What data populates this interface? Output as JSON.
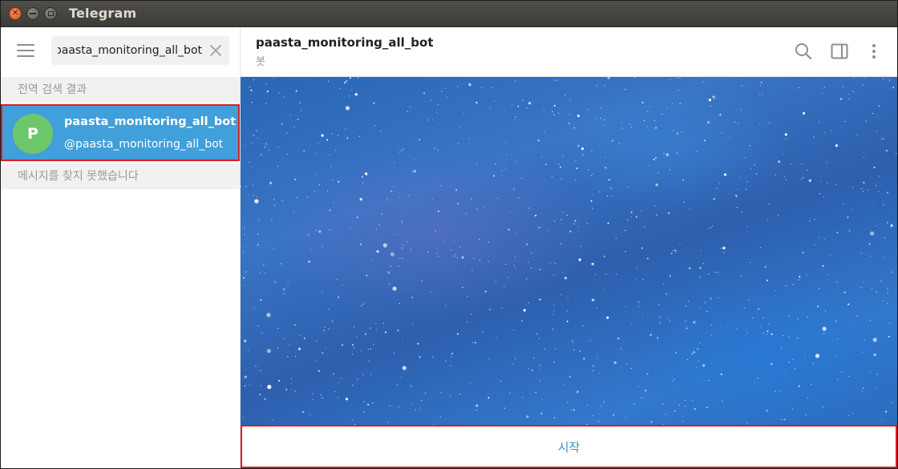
{
  "window": {
    "title": "Telegram"
  },
  "search": {
    "value": "paasta_monitoring_all_bot"
  },
  "sidebar": {
    "global_results_label": "전역 검색 결과",
    "result": {
      "avatar_letter": "P",
      "name": "paasta_monitoring_all_bot",
      "handle": "@paasta_monitoring_all_bot"
    },
    "no_messages_label": "메시지를 찾지 못했습니다"
  },
  "chat": {
    "title": "paasta_monitoring_all_bot",
    "subtitle": "봇",
    "start_label": "시작"
  },
  "colors": {
    "selected_row": "#419fd9",
    "avatar": "#6ec76a",
    "highlight_border": "#e01b24",
    "start_text": "#3a8dcc"
  },
  "icons": [
    "menu-icon",
    "clear-icon",
    "search-icon",
    "sidebar-toggle-icon",
    "more-icon"
  ]
}
